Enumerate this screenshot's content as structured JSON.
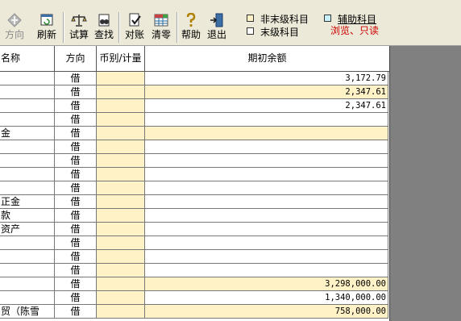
{
  "toolbar": {
    "buttons": [
      {
        "label": "方向",
        "icon": "direction-diamond-icon",
        "enabled": false
      },
      {
        "label": "刷新",
        "icon": "refresh-icon",
        "enabled": true
      },
      {
        "label": "试算",
        "icon": "balance-scale-icon",
        "enabled": true
      },
      {
        "label": "查找",
        "icon": "find-binoculars-icon",
        "enabled": true
      },
      {
        "label": "对账",
        "icon": "reconcile-check-icon",
        "enabled": true
      },
      {
        "label": "清零",
        "icon": "clear-grid-icon",
        "enabled": true
      },
      {
        "label": "帮助",
        "icon": "help-question-icon",
        "enabled": true
      },
      {
        "label": "退出",
        "icon": "exit-door-icon",
        "enabled": true
      }
    ],
    "legend": {
      "non_final_account": {
        "label": "非末级科目",
        "color": "#fff2c6"
      },
      "final_account": {
        "label": "末级科目",
        "color": "#ffffff"
      },
      "auxiliary_account": {
        "label": "辅助科目",
        "color": "#c8f0ff"
      },
      "readonly_note": {
        "label": "浏览、只读",
        "color": "#cc0000"
      }
    }
  },
  "grid": {
    "columns": [
      "名称",
      "方向",
      "币别/计量",
      "期初余额"
    ],
    "rows": [
      {
        "name": "",
        "direction": "借",
        "currency": "",
        "balance": "3,172.79",
        "nonfinal": false
      },
      {
        "name": "",
        "direction": "借",
        "currency": "",
        "balance": "2,347.61",
        "nonfinal": true
      },
      {
        "name": "",
        "direction": "借",
        "currency": "",
        "balance": "2,347.61",
        "nonfinal": false
      },
      {
        "name": "",
        "direction": "借",
        "currency": "",
        "balance": "",
        "nonfinal": false
      },
      {
        "name": "金",
        "direction": "借",
        "currency": "",
        "balance": "",
        "nonfinal": true
      },
      {
        "name": "",
        "direction": "借",
        "currency": "",
        "balance": "",
        "nonfinal": false
      },
      {
        "name": "",
        "direction": "借",
        "currency": "",
        "balance": "",
        "nonfinal": false
      },
      {
        "name": "",
        "direction": "借",
        "currency": "",
        "balance": "",
        "nonfinal": false
      },
      {
        "name": "",
        "direction": "借",
        "currency": "",
        "balance": "",
        "nonfinal": false
      },
      {
        "name": "正金",
        "direction": "借",
        "currency": "",
        "balance": "",
        "nonfinal": false
      },
      {
        "name": "款",
        "direction": "借",
        "currency": "",
        "balance": "",
        "nonfinal": false
      },
      {
        "name": "资产",
        "direction": "借",
        "currency": "",
        "balance": "",
        "nonfinal": false
      },
      {
        "name": "",
        "direction": "借",
        "currency": "",
        "balance": "",
        "nonfinal": false
      },
      {
        "name": "",
        "direction": "借",
        "currency": "",
        "balance": "",
        "nonfinal": false
      },
      {
        "name": "",
        "direction": "借",
        "currency": "",
        "balance": "",
        "nonfinal": false
      },
      {
        "name": "",
        "direction": "借",
        "currency": "",
        "balance": "3,298,000.00",
        "nonfinal": true
      },
      {
        "name": "",
        "direction": "借",
        "currency": "",
        "balance": "1,340,000.00",
        "nonfinal": false
      },
      {
        "name": "贸（陈雪",
        "direction": "借",
        "currency": "",
        "balance": "758,000.00",
        "nonfinal": true
      }
    ]
  }
}
